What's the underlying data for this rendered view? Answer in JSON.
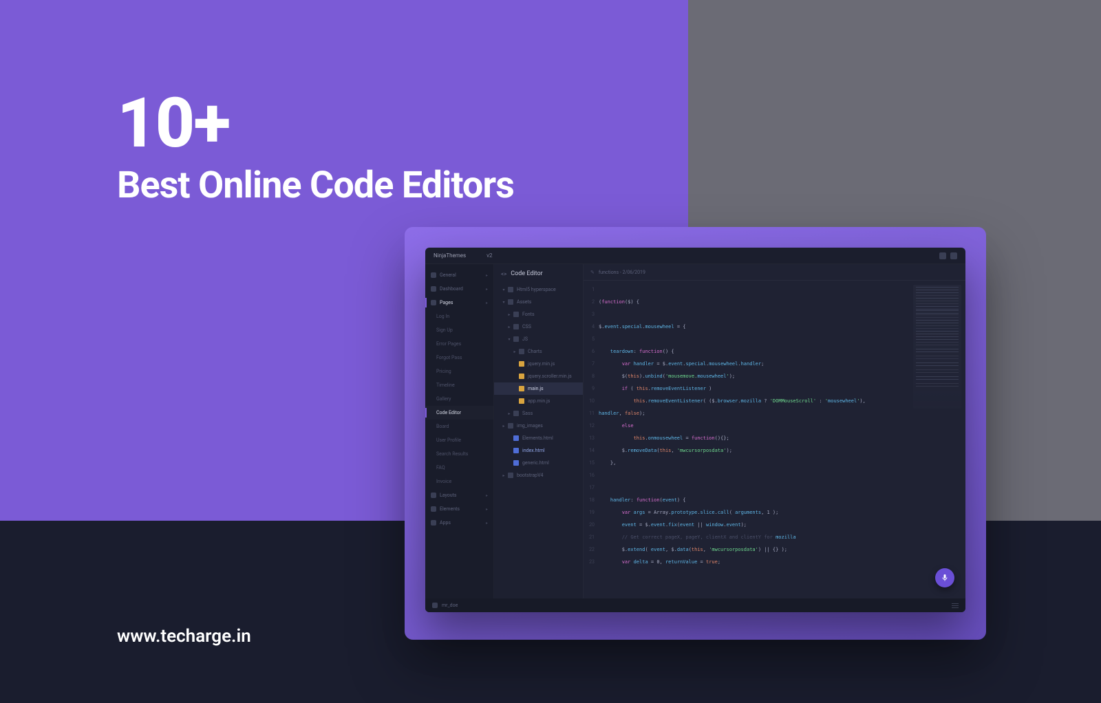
{
  "headline": {
    "count": "10+",
    "subtitle": "Best Online Code Editors"
  },
  "site_url": "www.techarge.in",
  "editor": {
    "brand": "NinjaThemes",
    "brand_sub": "v2",
    "panel_title": "Code Editor",
    "tab_label": "functions - 2/06/2019",
    "nav": [
      {
        "label": "General",
        "icon": "grid-icon",
        "sub": false
      },
      {
        "label": "Dashboard",
        "icon": "dashboard-icon",
        "sub": false
      },
      {
        "label": "Pages",
        "icon": "pages-icon",
        "sub": false,
        "active": true
      },
      {
        "label": "Log In",
        "sub": true
      },
      {
        "label": "Sign Up",
        "sub": true
      },
      {
        "label": "Error Pages",
        "sub": true
      },
      {
        "label": "Forgot Pass",
        "sub": true
      },
      {
        "label": "Pricing",
        "sub": true
      },
      {
        "label": "Timeline",
        "sub": true
      },
      {
        "label": "Gallery",
        "sub": true
      },
      {
        "label": "Code Editor",
        "sub": true,
        "selected": true
      },
      {
        "label": "Board",
        "sub": true
      },
      {
        "label": "User Profile",
        "sub": true
      },
      {
        "label": "Search Results",
        "sub": true
      },
      {
        "label": "FAQ",
        "sub": true
      },
      {
        "label": "Invoice",
        "sub": true
      },
      {
        "label": "Layouts",
        "icon": "layouts-icon",
        "sub": false
      },
      {
        "label": "Elements",
        "icon": "elements-icon",
        "sub": false
      },
      {
        "label": "Apps",
        "icon": "apps-icon",
        "sub": false
      }
    ],
    "files": {
      "root": "Html5 hyperspace",
      "tree": [
        {
          "depth": 0,
          "type": "folder",
          "label": "Assets",
          "open": true
        },
        {
          "depth": 1,
          "type": "folder",
          "label": "Fonts"
        },
        {
          "depth": 1,
          "type": "folder",
          "label": "CSS"
        },
        {
          "depth": 1,
          "type": "folder",
          "label": "JS",
          "open": true
        },
        {
          "depth": 2,
          "type": "folder",
          "label": "Charts"
        },
        {
          "depth": 2,
          "type": "js",
          "label": "jquery.min.js"
        },
        {
          "depth": 2,
          "type": "js",
          "label": "jquery.scroller.min.js"
        },
        {
          "depth": 2,
          "type": "js",
          "label": "main.js",
          "selected": true
        },
        {
          "depth": 2,
          "type": "js",
          "label": "app.min.js"
        },
        {
          "depth": 1,
          "type": "folder",
          "label": "Sass"
        },
        {
          "depth": 0,
          "type": "folder",
          "label": "img_images"
        },
        {
          "depth": 1,
          "type": "html",
          "label": "Elements.html"
        },
        {
          "depth": 1,
          "type": "html",
          "label": "index.html",
          "hl": true
        },
        {
          "depth": 1,
          "type": "html",
          "label": "generic.html"
        },
        {
          "depth": 0,
          "type": "folder",
          "label": "bootstrapV4"
        }
      ]
    },
    "code_lines": [
      "",
      "(function($) {",
      "",
      "$.event.special.mousewheel = {",
      "",
      "    teardown: function() {",
      "        var handler = $.event.special.mousewheel.handler;",
      "        $(this).unbind('mousemove.mousewheel');",
      "        if ( this.removeEventListener )",
      "            this.removeEventListener( ($.browser.mozilla ? 'DOMMouseScroll' : 'mousewheel'),",
      "handler, false);",
      "        else",
      "            this.onmousewheel = function(){};",
      "        $.removeData(this, 'mwcursorposdata');",
      "    },",
      "",
      "",
      "    handler: function(event) {",
      "        var args = Array.prototype.slice.call( arguments, 1 );",
      "        event = $.event.fix(event || window.event);",
      "        // Get correct pageX, pageY, clientX and clientY for mozilla",
      "        $.extend( event, $.data(this, 'mwcursorposdata') || {} );",
      "        var delta = 0, returnValue = true;"
    ],
    "footer_label": "mr_doe"
  }
}
